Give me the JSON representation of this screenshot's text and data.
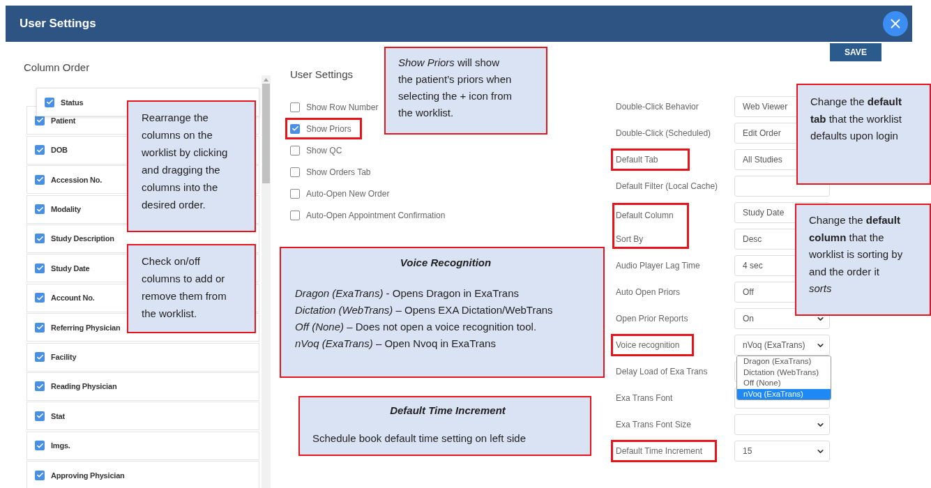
{
  "window": {
    "title": "User Settings"
  },
  "save_button": "SAVE",
  "column_order": {
    "title": "Column Order",
    "columns": [
      {
        "label": "Status",
        "checked": true,
        "dragging": true
      },
      {
        "label": "Patient",
        "checked": true,
        "dragging": false
      },
      {
        "label": "DOB",
        "checked": true,
        "dragging": false
      },
      {
        "label": "Accession No.",
        "checked": true,
        "dragging": false
      },
      {
        "label": "Modality",
        "checked": true,
        "dragging": false
      },
      {
        "label": "Study Description",
        "checked": true,
        "dragging": false
      },
      {
        "label": "Study Date",
        "checked": true,
        "dragging": false
      },
      {
        "label": "Account No.",
        "checked": true,
        "dragging": false
      },
      {
        "label": "Referring Physician",
        "checked": true,
        "dragging": false
      },
      {
        "label": "Facility",
        "checked": true,
        "dragging": false
      },
      {
        "label": "Reading Physician",
        "checked": true,
        "dragging": false
      },
      {
        "label": "Stat",
        "checked": true,
        "dragging": false
      },
      {
        "label": "Imgs.",
        "checked": true,
        "dragging": false
      },
      {
        "label": "Approving Physician",
        "checked": true,
        "dragging": false
      }
    ]
  },
  "user_settings": {
    "title": "User Settings",
    "options": [
      {
        "label": "Show Row Number",
        "checked": false,
        "highlighted": false
      },
      {
        "label": "Show Priors",
        "checked": true,
        "highlighted": true
      },
      {
        "label": "Show QC",
        "checked": false,
        "highlighted": false
      },
      {
        "label": "Show Orders Tab",
        "checked": false,
        "highlighted": false
      },
      {
        "label": "Auto-Open New Order",
        "checked": false,
        "highlighted": false
      },
      {
        "label": "Auto-Open Appointment Confirmation",
        "checked": false,
        "highlighted": false
      }
    ]
  },
  "preferences": [
    {
      "kind": "row",
      "label": "Double-Click Behavior",
      "value": "Web Viewer",
      "highlighted": false
    },
    {
      "kind": "row",
      "label": "Double-Click (Scheduled)",
      "value": "Edit Order",
      "highlighted": false
    },
    {
      "kind": "row",
      "label": "Default Tab",
      "value": "All Studies",
      "highlighted": true
    },
    {
      "kind": "row",
      "label": "Default Filter (Local Cache)",
      "highlighted": false
    },
    {
      "kind": "group",
      "highlighted": true,
      "rows": [
        {
          "label": "Default Column",
          "value": "Study Date"
        },
        {
          "label": "Sort By",
          "value": "Desc"
        }
      ]
    },
    {
      "kind": "row",
      "label": "Audio Player Lag Time",
      "value": "4 sec",
      "highlighted": false
    },
    {
      "kind": "row",
      "label": "Auto Open Priors",
      "value": "Off",
      "highlighted": false
    },
    {
      "kind": "row",
      "label": "Open Prior Reports",
      "value": "On",
      "arrow": true,
      "highlighted": false
    },
    {
      "kind": "row",
      "label": "Voice recognition",
      "value": "nVoq (ExaTrans)",
      "arrow": true,
      "highlighted": true,
      "menu": [
        {
          "label": "Dragon (ExaTrans)",
          "selected": false
        },
        {
          "label": "Dictation (WebTrans)",
          "selected": false
        },
        {
          "label": "Off (None)",
          "selected": false
        },
        {
          "label": "nVoq (ExaTrans)",
          "selected": true
        }
      ]
    },
    {
      "kind": "row",
      "label": "Delay Load of Exa Trans",
      "highlighted": false
    },
    {
      "kind": "row",
      "label": "Exa Trans Font",
      "highlighted": false
    },
    {
      "kind": "row",
      "label": "Exa Trans Font Size",
      "arrow": true,
      "highlighted": false
    },
    {
      "kind": "row",
      "label": "Default Time Increment",
      "value": "15",
      "arrow": true,
      "highlighted": true
    }
  ],
  "callouts": [
    {
      "kind": "paragraph",
      "text": "*Show Priors* will show the patient’s priors when selecting the + icon from the worklist."
    },
    {
      "kind": "paragraph",
      "text": "Rearrange the columns on the worklist by clicking and dragging the columns into the desired order."
    },
    {
      "kind": "paragraph",
      "text": "Check on/off columns to add or remove them from the worklist."
    },
    {
      "kind": "titled",
      "title": "Voice Recognition",
      "lines": [
        "*Dragon (ExaTrans)*  - Opens Dragon in ExaTrans",
        "*Dictation (WebTrans)* – Opens EXA Dictation/WebTrans",
        "*Off (None)* – Does not open a voice recognition tool.",
        "*nVoq (ExaTrans)*  – Open Nvoq in ExaTrans"
      ]
    },
    {
      "kind": "titled",
      "title": "Default Time Increment",
      "lines": [
        "Schedule book default time setting on left side"
      ]
    },
    {
      "kind": "paragraph",
      "text": "Change the **default tab** that the worklist defaults upon login"
    },
    {
      "kind": "paragraph",
      "text": "Change the **default column** that the worklist is sorting by and the order it *sorts*"
    }
  ]
}
